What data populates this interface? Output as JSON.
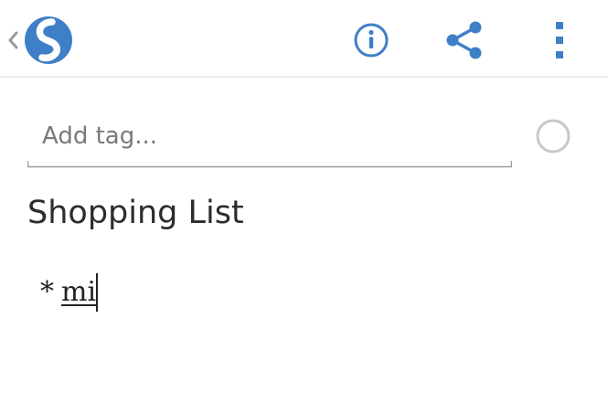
{
  "app": {
    "logo_icon": "simplenote-logo-icon",
    "back_icon": "chevron-left-icon",
    "accent_color": "#3f7fc8"
  },
  "toolbar": {
    "info_icon": "info-icon",
    "share_icon": "share-icon",
    "more_icon": "more-vert-icon"
  },
  "tags": {
    "placeholder": "Add tag...",
    "value": "",
    "pin_toggle_icon": "circle-outline-icon"
  },
  "note": {
    "title": "Shopping List",
    "bullet": "*",
    "current_word": "mi"
  }
}
